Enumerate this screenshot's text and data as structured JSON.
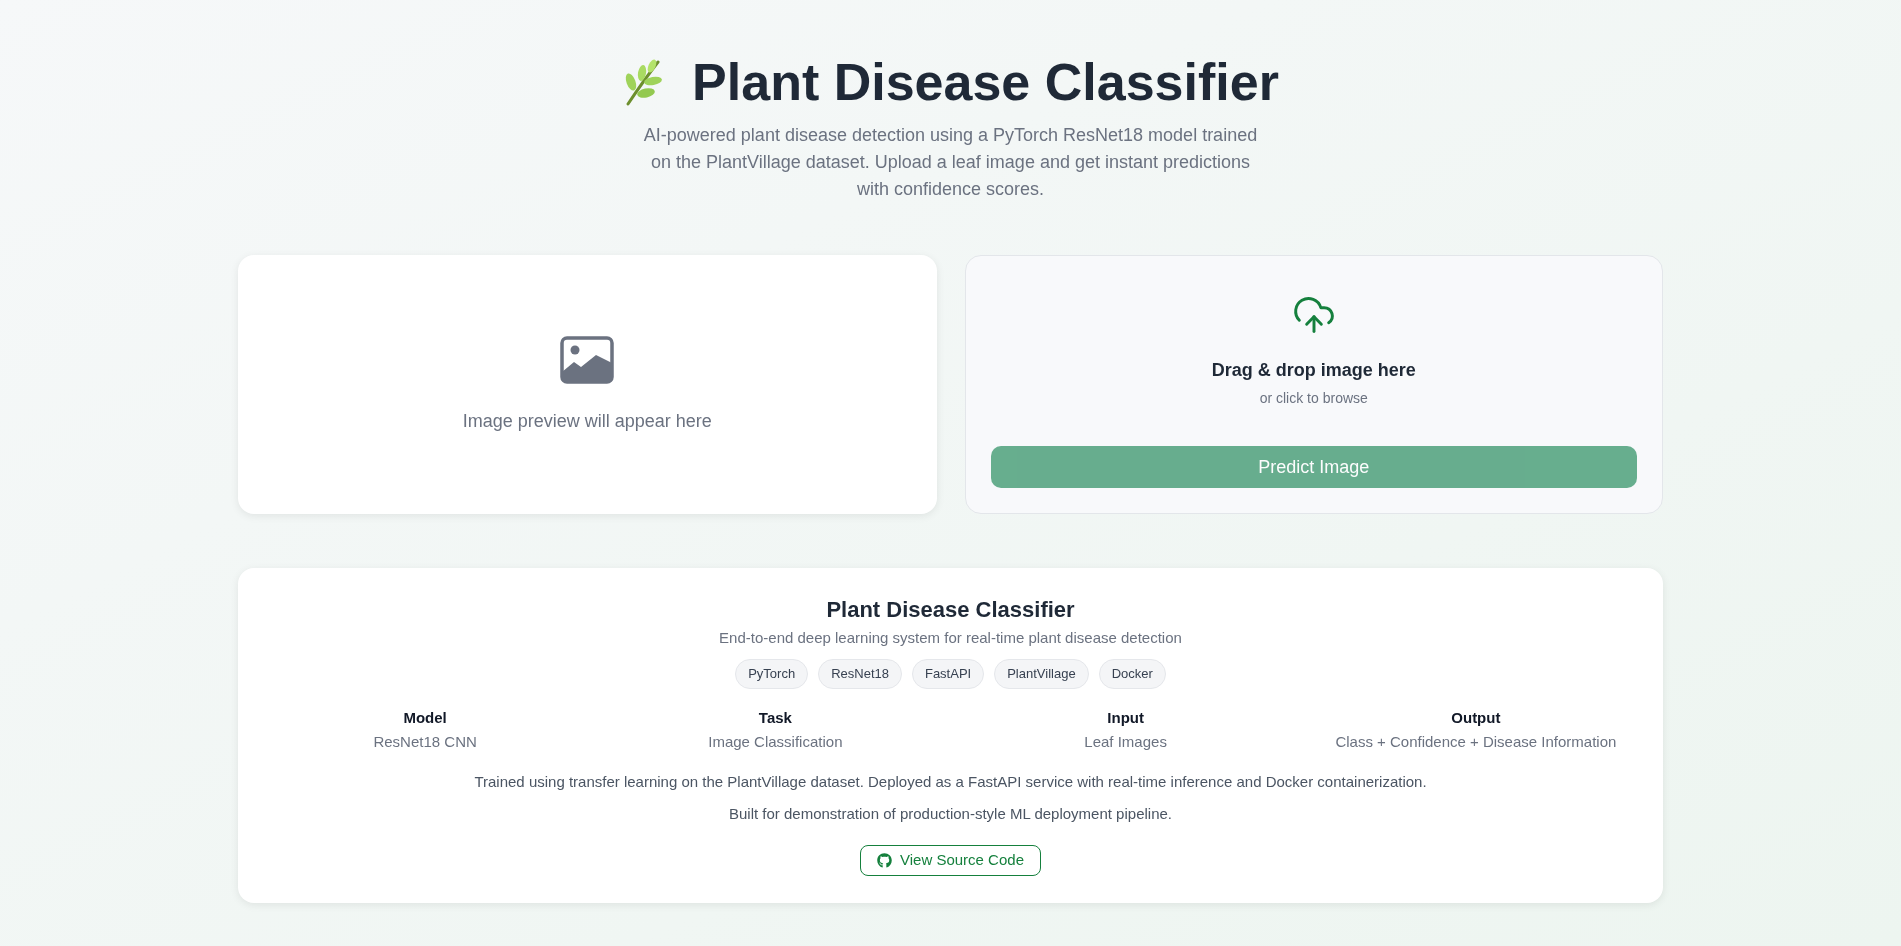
{
  "header": {
    "title": "Plant Disease Classifier",
    "subtitle": "AI-powered plant disease detection using a PyTorch ResNet18 model trained on the PlantVillage dataset. Upload a leaf image and get instant predictions with confidence scores."
  },
  "preview": {
    "empty_text": "Image preview will appear here"
  },
  "upload": {
    "title": "Drag & drop image here",
    "hint": "or click to browse",
    "button": {
      "label": "Predict Image",
      "disabled": true
    }
  },
  "about": {
    "title": "Plant Disease Classifier",
    "subtitle": "End-to-end deep learning system for real-time plant disease detection",
    "tags": [
      "PyTorch",
      "ResNet18",
      "FastAPI",
      "PlantVillage",
      "Docker"
    ],
    "specs": [
      {
        "label": "Model",
        "value": "ResNet18 CNN"
      },
      {
        "label": "Task",
        "value": "Image Classification"
      },
      {
        "label": "Input",
        "value": "Leaf Images"
      },
      {
        "label": "Output",
        "value": "Class + Confidence + Disease Information"
      }
    ],
    "paragraphs": [
      "Trained using transfer learning on the PlantVillage dataset. Deployed as a FastAPI service with real-time inference and Docker containerization.",
      "Built for demonstration of production-style ML deployment pipeline."
    ],
    "link": {
      "label": "View Source Code"
    }
  }
}
